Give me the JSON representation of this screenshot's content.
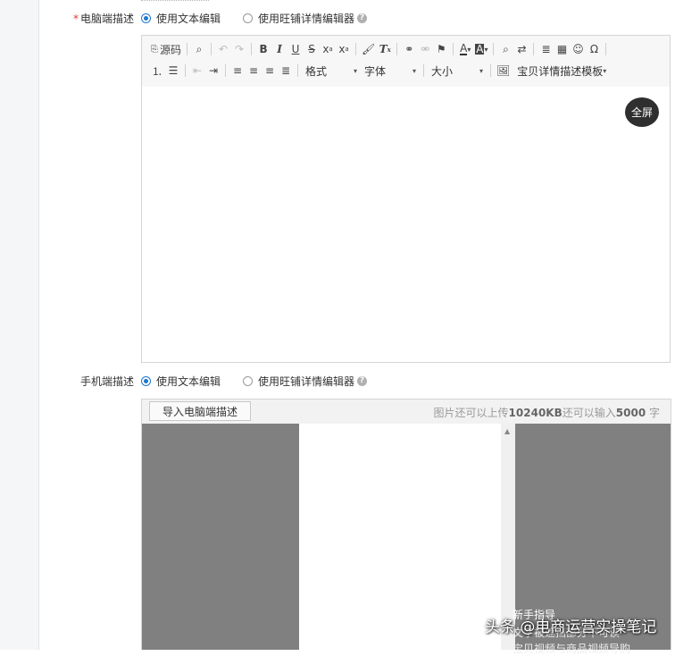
{
  "pc_desc": {
    "label": "电脑端描述",
    "required_mark": "*",
    "option_text": "使用文本编辑",
    "option_wangpu": "使用旺铺详情编辑器",
    "selected": "text"
  },
  "toolbar": {
    "source_label": "源码",
    "format_label": "格式",
    "font_label": "字体",
    "size_label": "大小",
    "template_label": "宝贝详情描述模板"
  },
  "editor": {
    "fullscreen_label": "全屏"
  },
  "mobile_desc": {
    "label": "手机端描述",
    "option_text": "使用文本编辑",
    "option_wangpu": "使用旺铺详情编辑器",
    "selected": "text",
    "import_button": "导入电脑端描述",
    "quota_prefix": "图片还可以上传",
    "quota_image": "10240KB",
    "quota_middle": "还可以输入",
    "quota_chars": "5000",
    "quota_suffix": " 字",
    "side_panel_title": "新手指导",
    "side_panel_line1": "文字被遮挡部分不可读",
    "side_panel_line2": "宝贝视频与商品视频导购"
  },
  "watermark": "头条 @电商运营实操笔记",
  "colors": {
    "accent": "#1e77d2",
    "required": "#e4393c",
    "panel_grey": "#808080"
  }
}
